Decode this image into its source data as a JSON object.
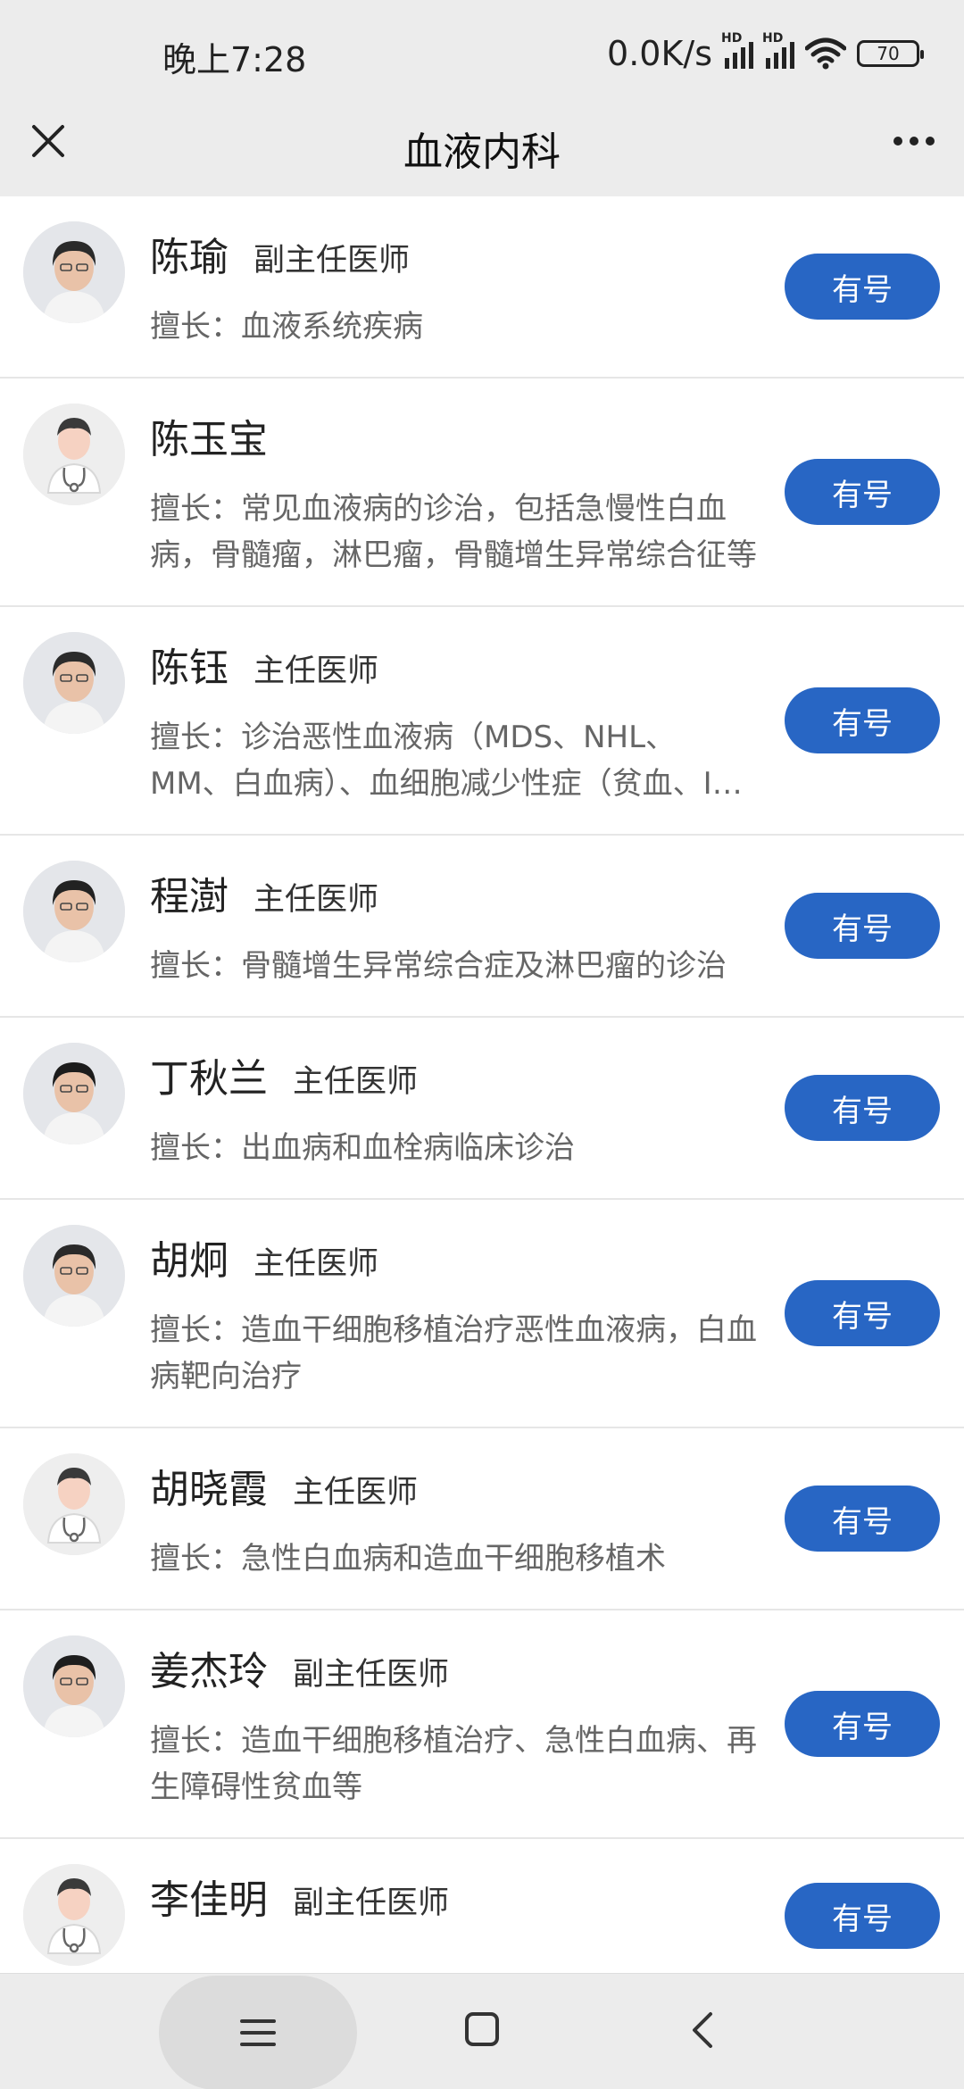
{
  "status_bar": {
    "time": "晚上7:28",
    "net_speed": "0.0K/s",
    "battery": "70",
    "sig_icon": "signal-icon",
    "wifi_icon": "wifi-icon"
  },
  "header": {
    "title": "血液内科",
    "close_icon": "close-icon",
    "more_icon": "more-icon"
  },
  "doctors": [
    {
      "name": "陈瑜",
      "title": "副主任医师",
      "skill": "擅长：血液系统疾病",
      "button": "有号",
      "avatar": "photo"
    },
    {
      "name": "陈玉宝",
      "title": "",
      "skill": "擅长：常见血液病的诊治，包括急慢性白血病，骨髓瘤，淋巴瘤，骨髓增生异常综合征等",
      "button": "有号",
      "avatar": "placeholder"
    },
    {
      "name": "陈钰",
      "title": "主任医师",
      "skill": "擅长：诊治恶性血液病（MDS、NHL、MM、白血病）、血细胞减少性症（贫血、ITP等）",
      "button": "有号",
      "avatar": "photo"
    },
    {
      "name": "程澍",
      "title": "主任医师",
      "skill": "擅长：骨髓增生异常综合症及淋巴瘤的诊治",
      "button": "有号",
      "avatar": "photo"
    },
    {
      "name": "丁秋兰",
      "title": "主任医师",
      "skill": "擅长：出血病和血栓病临床诊治",
      "button": "有号",
      "avatar": "photo"
    },
    {
      "name": "胡炯",
      "title": "主任医师",
      "skill": "擅长：造血干细胞移植治疗恶性血液病，白血病靶向治疗",
      "button": "有号",
      "avatar": "photo"
    },
    {
      "name": "胡晓霞",
      "title": "主任医师",
      "skill": "擅长：急性白血病和造血干细胞移植术",
      "button": "有号",
      "avatar": "placeholder"
    },
    {
      "name": "姜杰玲",
      "title": "副主任医师",
      "skill": "擅长：造血干细胞移植治疗、急性白血病、再生障碍性贫血等",
      "button": "有号",
      "avatar": "photo"
    },
    {
      "name": "李佳明",
      "title": "副主任医师",
      "skill": "",
      "button": "有号",
      "avatar": "placeholder"
    }
  ],
  "nav": {
    "menu_icon": "menu-icon",
    "home_icon": "home-icon",
    "back_icon": "back-icon"
  },
  "colors": {
    "accent": "#2866c4",
    "bar_background": "#ececec"
  }
}
